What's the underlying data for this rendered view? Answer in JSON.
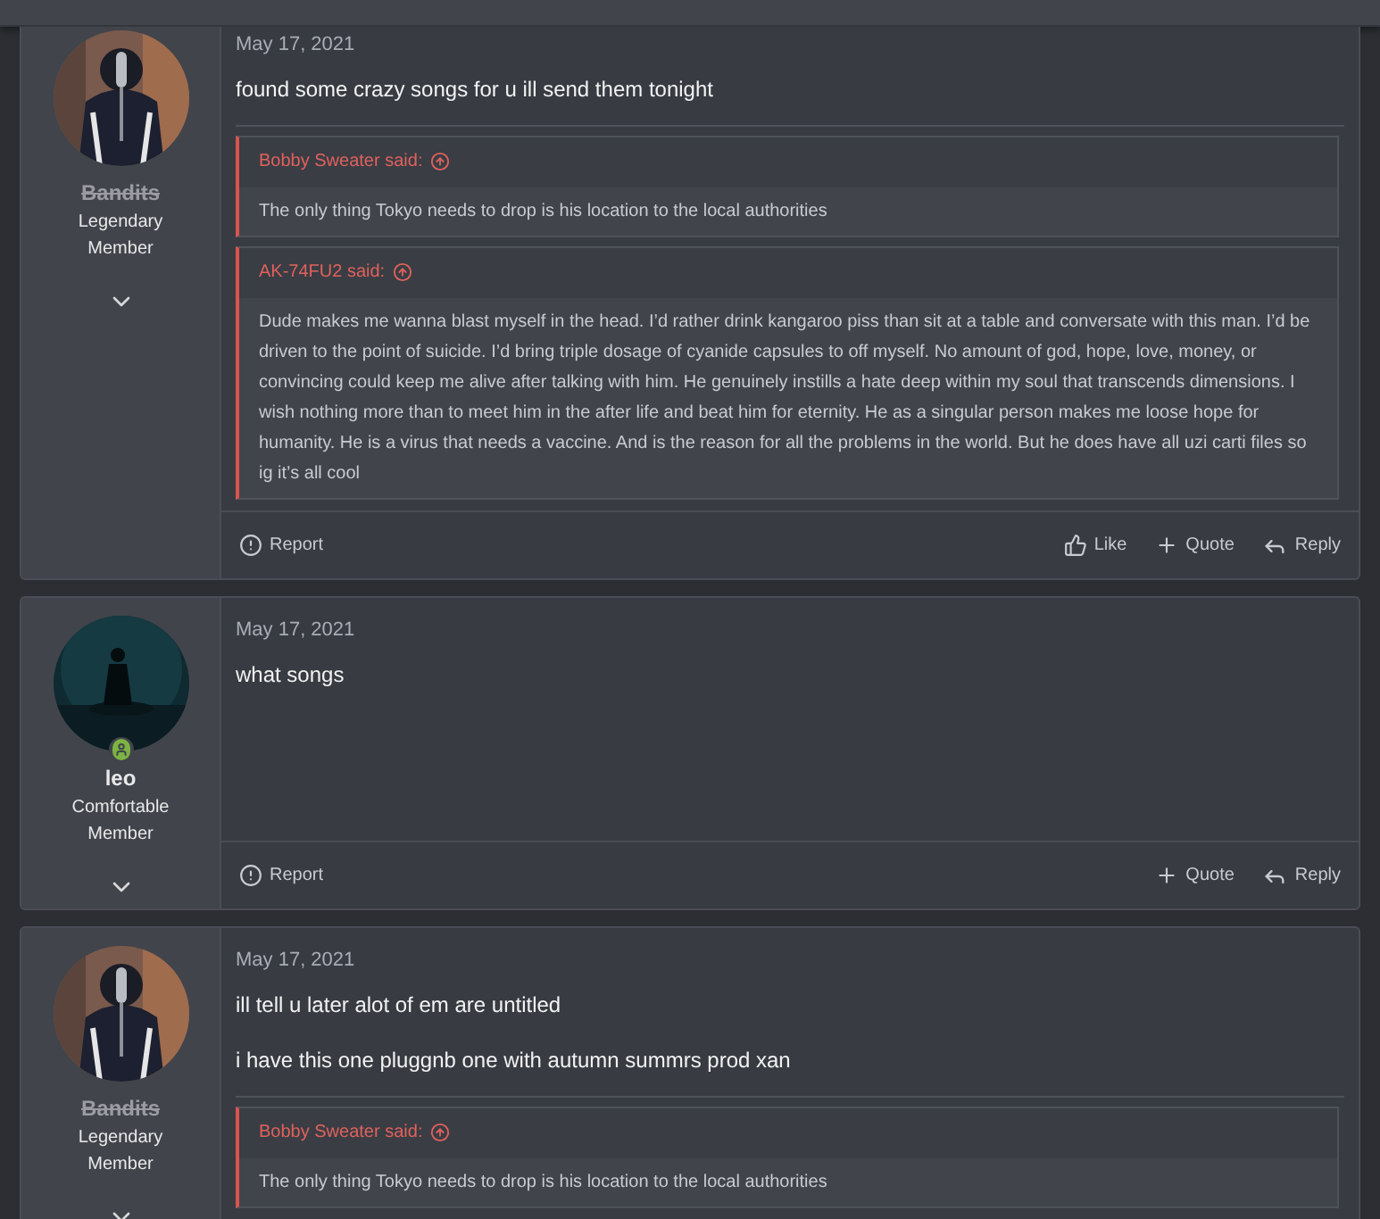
{
  "posts": [
    {
      "user": {
        "name": "Bandits",
        "title": "Legendary Member",
        "banned": true,
        "online": false
      },
      "date": "May 17, 2021",
      "paragraphs": [
        "found some crazy songs for u ill send them tonight"
      ],
      "quotes": [
        {
          "author": "Bobby Sweater said:",
          "text": "The only thing Tokyo needs to drop is his location to the local authorities"
        },
        {
          "author": "AK-74FU2 said:",
          "text": "Dude makes me wanna blast myself in the head. I’d rather drink kangaroo piss than sit at a table and conversate with this man. I’d be driven to the point of suicide. I’d bring triple dosage of cyanide capsules to off myself. No amount of god, hope, love, money, or convincing could keep me alive after talking with him. He genuinely instills a hate deep within my soul that transcends dimensions. I wish nothing more than to meet him in the after life and beat him for eternity. He as a singular person makes me loose hope for humanity. He is a virus that needs a vaccine. And is the reason for all the problems in the world. But he does have all uzi carti files so ig it’s all cool"
        }
      ],
      "actions": [
        {
          "kind": "report",
          "label": "Report"
        },
        {
          "kind": "like",
          "label": "Like"
        },
        {
          "kind": "quote",
          "label": "Quote"
        },
        {
          "kind": "reply",
          "label": "Reply"
        }
      ]
    },
    {
      "user": {
        "name": "leo",
        "title": "Comfortable Member",
        "banned": false,
        "online": true
      },
      "date": "May 17, 2021",
      "paragraphs": [
        "what songs"
      ],
      "actions": [
        {
          "kind": "report",
          "label": "Report"
        },
        {
          "kind": "quote",
          "label": "Quote"
        },
        {
          "kind": "reply",
          "label": "Reply"
        }
      ]
    },
    {
      "user": {
        "name": "Bandits",
        "title": "Legendary Member",
        "banned": true,
        "online": false
      },
      "date": "May 17, 2021",
      "paragraphs": [
        "ill tell u later alot of em are untitled",
        "i have this one pluggnb one with autumn summrs prod xan"
      ],
      "quotes": [
        {
          "author": "Bobby Sweater said:",
          "text": "The only thing Tokyo needs to drop is his location to the local authorities"
        }
      ]
    }
  ]
}
